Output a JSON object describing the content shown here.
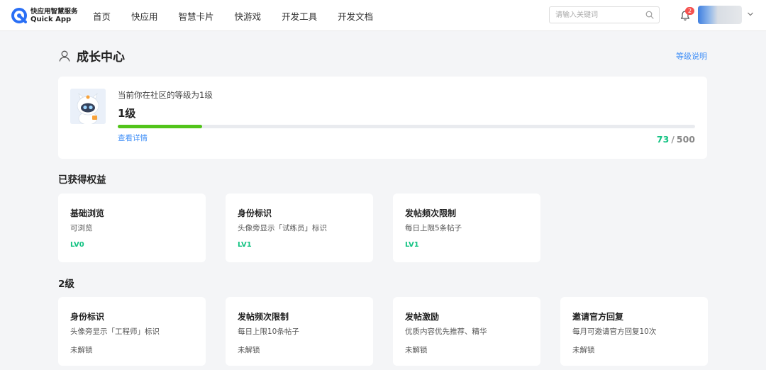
{
  "header": {
    "logo_cn": "快应用智慧服务",
    "logo_en": "Quick App",
    "nav": [
      "首页",
      "快应用",
      "智慧卡片",
      "快游戏",
      "开发工具",
      "开发文档"
    ],
    "search_placeholder": "请输入关键词",
    "notification_count": "2"
  },
  "page": {
    "title": "成长中心",
    "level_link": "等级说明"
  },
  "level_card": {
    "description": "当前你在社区的等级为1级",
    "level": "1级",
    "details_link": "查看详情",
    "points_current": "73",
    "points_separator": "/",
    "points_max": "500",
    "progress_fraction": 0.146
  },
  "earned_section": {
    "title": "已获得权益",
    "cards": [
      {
        "name": "基础浏览",
        "desc": "可浏览",
        "tag": "LV0"
      },
      {
        "name": "身份标识",
        "desc": "头像旁显示「试练员」标识",
        "tag": "LV1"
      },
      {
        "name": "发帖频次限制",
        "desc": "每日上限5条帖子",
        "tag": "LV1"
      }
    ]
  },
  "level2_section": {
    "title": "2级",
    "cards": [
      {
        "name": "身份标识",
        "desc": "头像旁显示「工程师」标识",
        "status": "未解锁"
      },
      {
        "name": "发帖频次限制",
        "desc": "每日上限10条帖子",
        "status": "未解锁"
      },
      {
        "name": "发帖激励",
        "desc": "优质内容优先推荐、精华",
        "status": "未解锁"
      },
      {
        "name": "邀请官方回复",
        "desc": "每月可邀请官方回复10次",
        "status": "未解锁"
      }
    ]
  },
  "colors": {
    "accent_blue": "#3e8ef7",
    "progress_green": "#52c41a",
    "tag_green": "#14c383",
    "badge_red": "#f5514f"
  },
  "icons": [
    "quick-app-logo-icon",
    "search-icon",
    "bell-icon",
    "user-icon",
    "chevron-down-icon"
  ]
}
